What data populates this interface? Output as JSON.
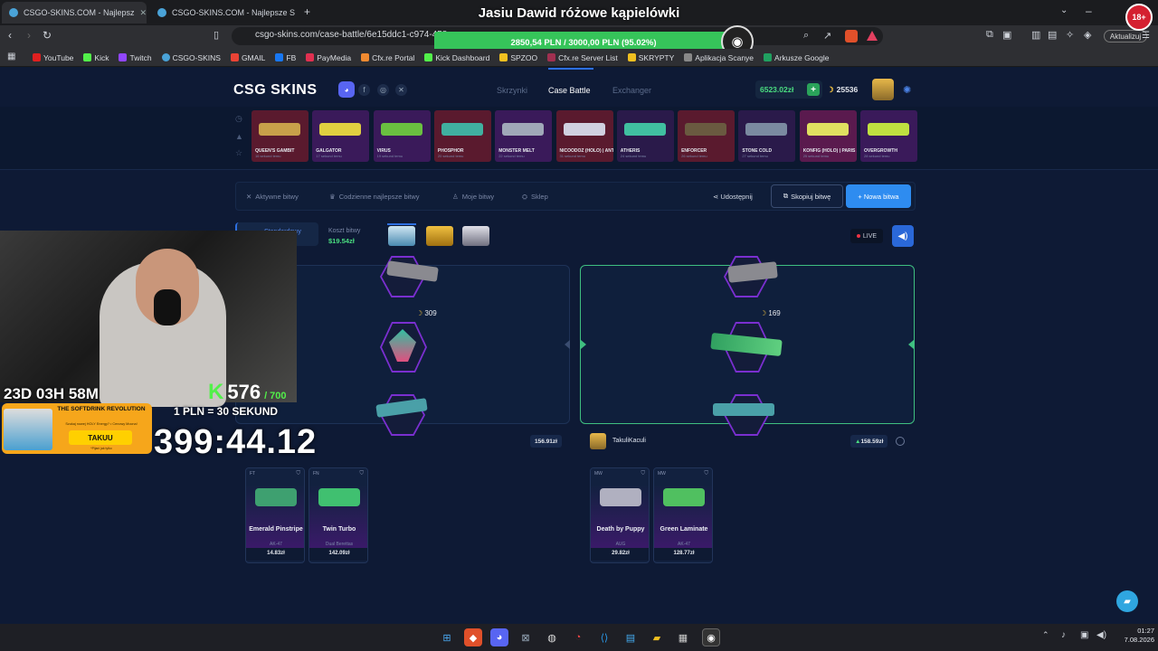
{
  "browser": {
    "tabs": [
      {
        "label": "CSGO-SKINS.COM - Najlepsz",
        "active": true
      },
      {
        "label": "CSGO-SKINS.COM - Najlepsze Skrzy",
        "active": false
      }
    ],
    "url": "csgo-skins.com/case-battle/6e15ddc1-c974-458",
    "update_label": "Aktualizuj",
    "bookmarks": [
      "YouTube",
      "Kick",
      "Twitch",
      "CSGO-SKINS",
      "GMAIL",
      "FB",
      "PayMedia",
      "Cfx.re Portal",
      "Kick Dashboard",
      "SPZOO",
      "Cfx.re Server List",
      "SKRYPTY",
      "Aplikacja Scanye",
      "Arkusze Google"
    ]
  },
  "stream": {
    "title": "Jasiu Dawid różowe kąpielówki",
    "goal": "2850,54 PLN / 3000,00 PLN  (95.02%)",
    "goal_progress": 0.9502,
    "age_badge": "18+"
  },
  "site": {
    "logo": "CSG SKINS",
    "nav": {
      "cases": "Skrzynki",
      "case_battle": "Case Battle",
      "exchanger": "Exchanger"
    },
    "balance": "6523.02zł",
    "coins": "25536",
    "recent_drops": [
      {
        "name": "QUEEN'S GAMBIT",
        "sub": "16 sekund temu",
        "bg": "#5a1a2e",
        "gun": "#c8a04a"
      },
      {
        "name": "GALGATOR",
        "sub": "17 sekund temu",
        "bg": "#3a1a5a",
        "gun": "#e0d040"
      },
      {
        "name": "VIRUS",
        "sub": "19 sekund temu",
        "bg": "#3a1a5a",
        "gun": "#6ac040"
      },
      {
        "name": "PHOSPHOR",
        "sub": "20 sekund temu",
        "bg": "#5a1a2e",
        "gun": "#40b0a0"
      },
      {
        "name": "MONSTER MELT",
        "sub": "22 sekund temu",
        "bg": "#3a1a5a",
        "gun": "#a0a8b8"
      },
      {
        "name": "NICOODOZ (HOLO) | ANTWERP 2022",
        "sub": "31 sekund temu",
        "bg": "#5a1a2e",
        "gun": "#d0d0e0"
      },
      {
        "name": "ATHERIS",
        "sub": "24 sekund temu",
        "bg": "#2a1a4a",
        "gun": "#40c0a0"
      },
      {
        "name": "ENFORCER",
        "sub": "26 sekund temu",
        "bg": "#5a1a2e",
        "gun": "#6a5a40"
      },
      {
        "name": "STONE COLD",
        "sub": "27 sekund temu",
        "bg": "#2a1a4a",
        "gun": "#7a8aa0"
      },
      {
        "name": "KONFIG (HOLO) | PARIS 2023",
        "sub": "25 sekund temu",
        "bg": "#5a1a4e",
        "gun": "#e0e060"
      },
      {
        "name": "OVERGROWTH",
        "sub": "28 sekund temu",
        "bg": "#3a1a5a",
        "gun": "#c0e040"
      }
    ],
    "filters": {
      "active": "Aktywne bitwy",
      "daily": "Codzienne najlepsze bitwy",
      "mine": "Moje bitwy",
      "shop": "Sklep"
    },
    "share": "Udostępnij",
    "copy_battle": "Skopiuj bitwę",
    "new_battle": "+ Nowa bitwa",
    "battle": {
      "mode": "Standardowy",
      "cost_label": "Koszt bitwy",
      "cost": "$19.54zł",
      "live": "LIVE"
    },
    "players": [
      {
        "name": "",
        "score": "309",
        "total": "156.91zł",
        "items": [
          {
            "cond": "FT",
            "name": "Emerald Pinstripe",
            "sub": "AK-47",
            "price": "14.83zł",
            "color": "#3ea070"
          },
          {
            "cond": "FN",
            "name": "Twin Turbo",
            "sub": "Dual Berettas",
            "price": "142.09zł",
            "color": "#40c070"
          }
        ]
      },
      {
        "name": "TakuliKaculi",
        "score": "169",
        "total": "158.59zł",
        "items": [
          {
            "cond": "MW",
            "name": "Death by Puppy",
            "sub": "AUG",
            "price": "29.82zł",
            "color": "#b0b0c0"
          },
          {
            "cond": "MW",
            "name": "Green Laminate",
            "sub": "AK-47",
            "price": "128.77zł",
            "color": "#50c060"
          }
        ]
      }
    ]
  },
  "overlay": {
    "countdown": "23D 03H 58M",
    "k_count": "576",
    "k_max": "/ 700",
    "rate": "1 PLN = 30 SEKUND",
    "big_timer": "399:44.12",
    "ad_title": "THE SOFTDRINK REVOLUTION",
    "ad_sub": "Szukaj nowej HOLY Energy? • Cenowy Mocna!",
    "ad_button": "TAKUU",
    "ad_foot": "*Pijani jak tylko"
  },
  "taskbar": {
    "time": "01:27",
    "date": "7.08.2026"
  }
}
